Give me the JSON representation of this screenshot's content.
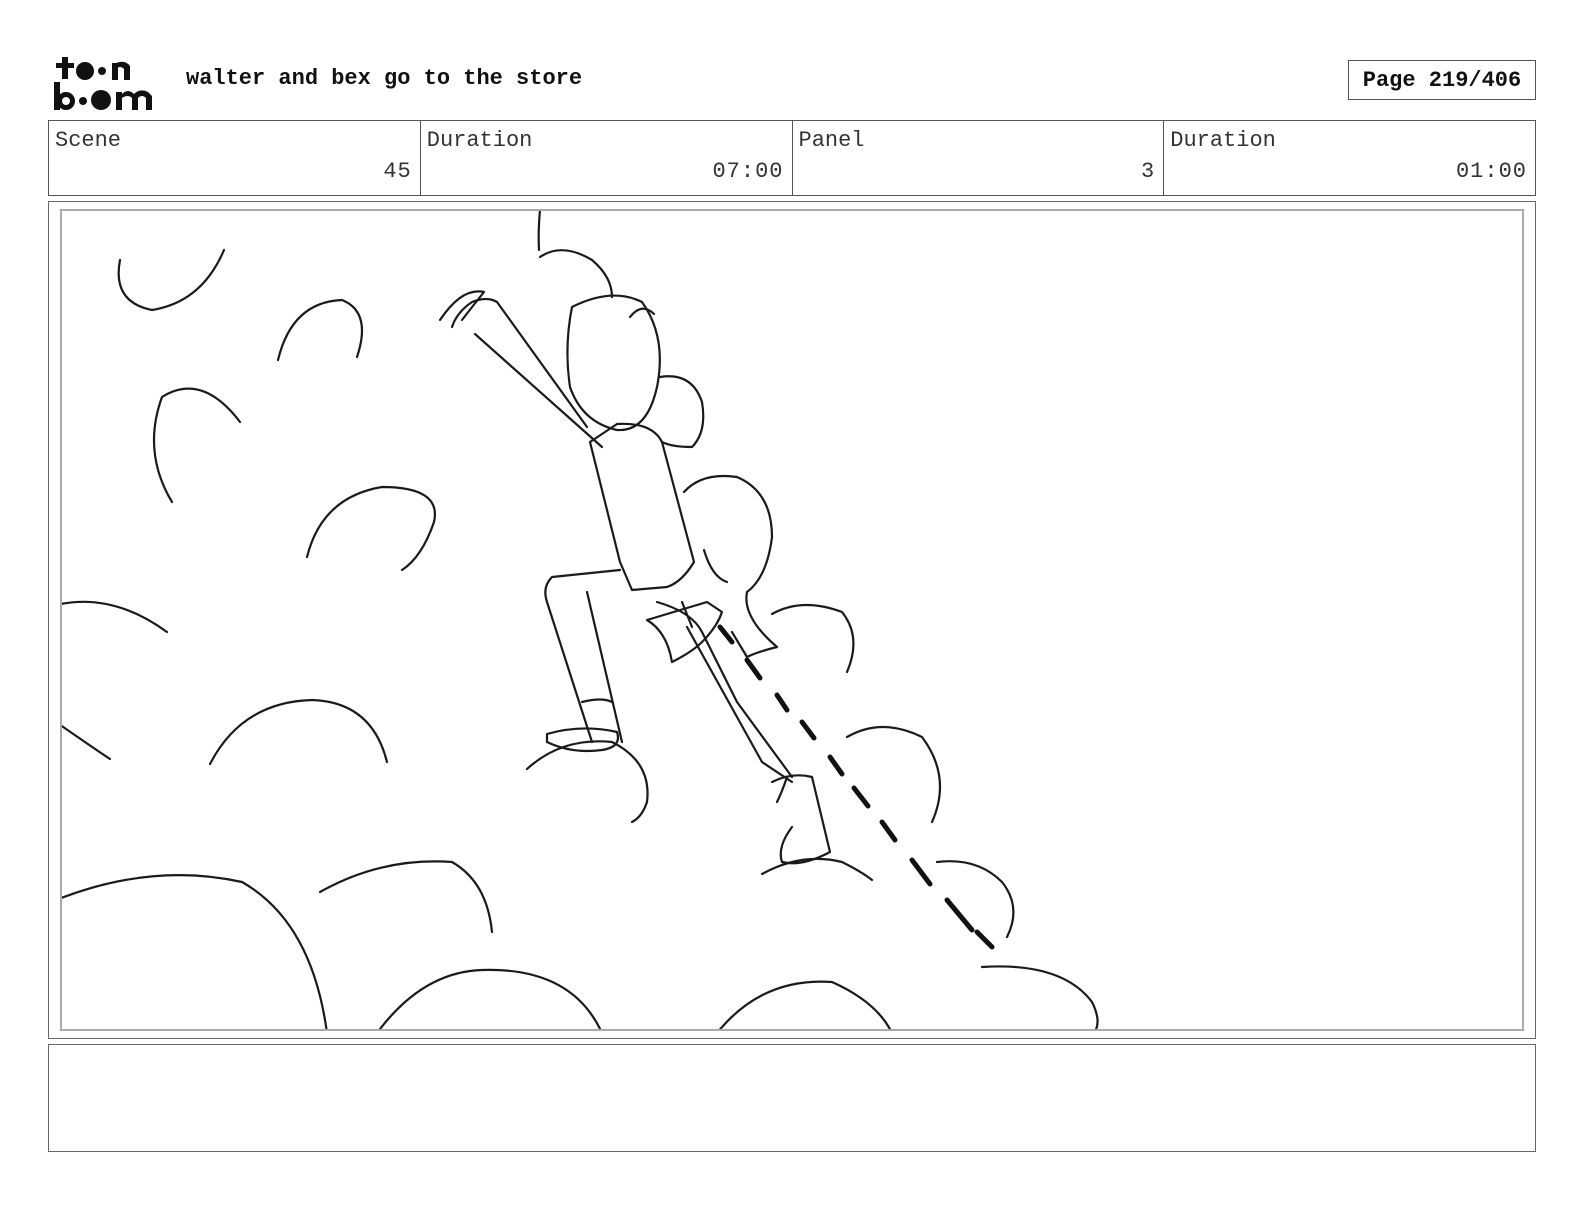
{
  "header": {
    "logo": {
      "icon": "toon-boom-logo",
      "line1": "toon",
      "line2": "boom"
    },
    "project_title": "walter and bex go to the store",
    "page_label": "Page 219/406"
  },
  "info": {
    "scene_label": "Scene",
    "scene_value": "45",
    "scene_duration_label": "Duration",
    "scene_duration_value": "07:00",
    "panel_label": "Panel",
    "panel_value": "3",
    "panel_duration_label": "Duration",
    "panel_duration_value": "01:00"
  },
  "panel": {
    "image": "storyboard-sketch",
    "description_icon": "figure-with-jetpack-flying-through-clouds"
  },
  "notes": {
    "text": ""
  }
}
